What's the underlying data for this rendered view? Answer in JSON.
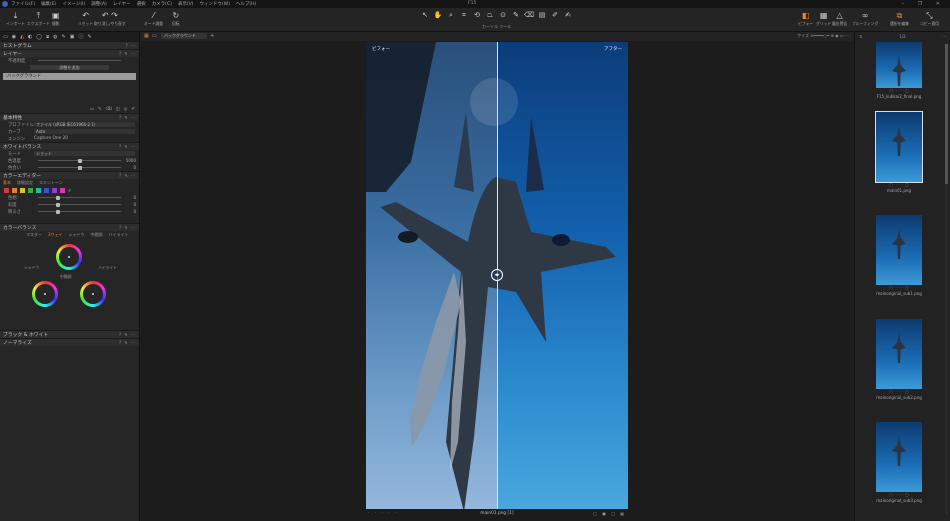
{
  "menubar": {
    "items": [
      "ファイル(F)",
      "編集(E)",
      "イメージ(I)",
      "調整(A)",
      "レイヤー",
      "選択",
      "カメラ(C)",
      "表示(V)",
      "ウィンドウ(W)",
      "ヘルプ(H)"
    ],
    "title": "F15",
    "window_controls": "– ❐ ✕"
  },
  "toolbar": {
    "import": "インポート",
    "export": "エクスポート",
    "capture": "撮影",
    "reset": "リセット",
    "undo_redo": "取り消し/やり直す",
    "auto_adjust": "オート調整",
    "rotate": "回転",
    "cursor_tools_label": "カーソル ツール",
    "viewer": "ビフォー",
    "grid": "グリッド",
    "exposure_warning": "露出警告",
    "proofing": "プルーフィング",
    "copy_adjust": "選択を編集",
    "paste_adjust": "コピー適用"
  },
  "left_panel": {
    "histogram": "ヒストグラム",
    "layers": {
      "title": "レイヤー",
      "opacity": "不透明度",
      "fill_button": "調整を追加",
      "background": "バックグラウンド"
    },
    "basic": {
      "title": "基本特性",
      "profile_label": "プロファイル",
      "profile_value": "ファイル (sRGB IEC61966-2.1)",
      "curve_label": "カーブ",
      "curve_value": "Auto",
      "engine_label": "エンジン",
      "engine_value": "Capture One 20"
    },
    "white_balance": {
      "title": "ホワイトバランス",
      "mode_label": "モード",
      "mode_value": "ショット",
      "kelvin_label": "色温度",
      "kelvin_value": "5000",
      "tint_label": "色合い",
      "tint_value": "0",
      "kelvin_pos": 0.5,
      "tint_pos": 0.5
    },
    "color_editor": {
      "title": "カラーエディター",
      "tabs": [
        "基本",
        "詳細設定",
        "スキントーン"
      ],
      "swatch_colors": [
        "#d33c3c",
        "#e2802a",
        "#d8c22a",
        "#3cab3c",
        "#2ab5b5",
        "#3555d3",
        "#9a3ad3",
        "#d33ca8"
      ],
      "hue_label": "色相",
      "hue_value": "0",
      "sat_label": "彩度",
      "sat_value": "0",
      "light_label": "明るさ",
      "light_value": "0"
    },
    "color_balance": {
      "title": "カラーバランス",
      "tabs": [
        "マスター",
        "3ウェイ",
        "シャドウ",
        "中間調",
        "ハイライト"
      ],
      "shadow_label": "シャドウ",
      "mid_label": "中間調",
      "high_label": "ハイライト"
    },
    "black_white": "ブラック & ホワイト",
    "normalize": "ノーマライズ"
  },
  "viewer": {
    "layer_select": "バックグラウンド",
    "zoom_label": "サイズ",
    "before_tag": "ビフォー",
    "after_tag": "アフター",
    "filename": "main01.png [1]"
  },
  "browser": {
    "header": "1/2",
    "thumbs": [
      {
        "name": "F15_kubkai2_final.png",
        "selected": false
      },
      {
        "name": "main01.png",
        "selected": true
      },
      {
        "name": "mainoriginal_sub1.png",
        "selected": false
      },
      {
        "name": "mainoriginal_sub2.png",
        "selected": false
      },
      {
        "name": "mainoriginal_sub3.png",
        "selected": false
      }
    ]
  },
  "colors": {
    "accent": "#e8892a",
    "panel": "#262626",
    "background": "#1c1c1c"
  }
}
